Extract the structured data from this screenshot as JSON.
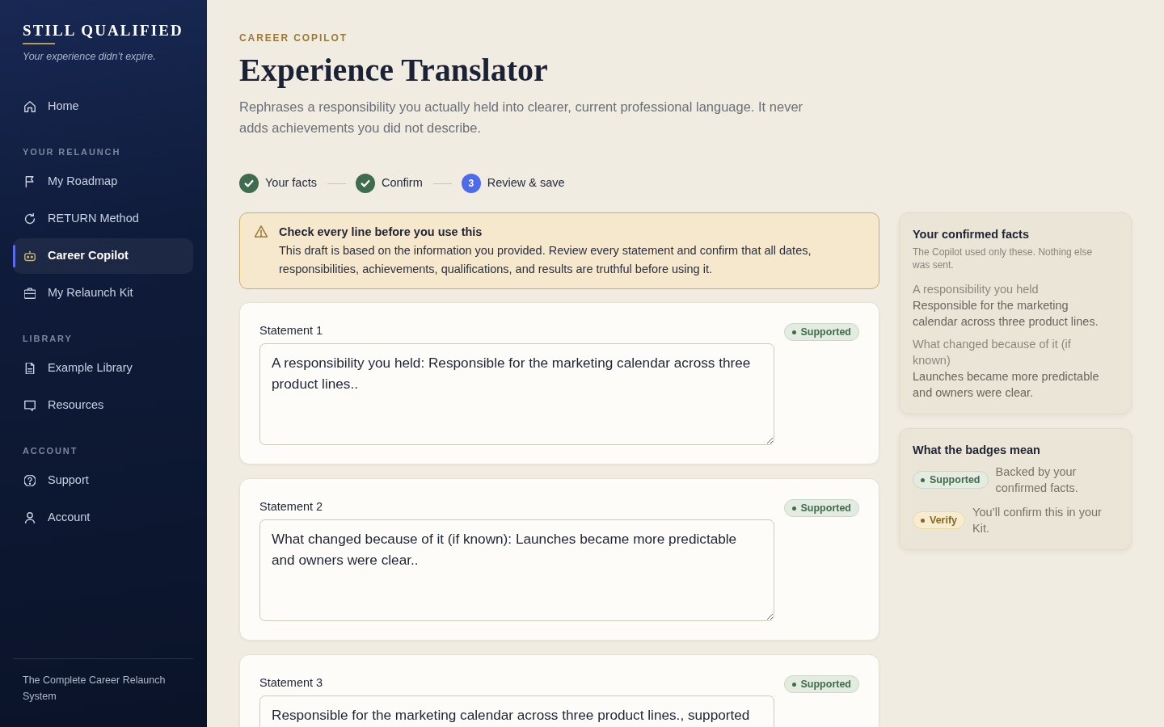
{
  "sidebar": {
    "brand": {
      "name": "STILL QUALIFIED",
      "tagline": "Your experience didn’t expire."
    },
    "sections": [
      {
        "items": [
          {
            "label": "Home",
            "selected": false
          }
        ]
      },
      {
        "heading": "YOUR RELAUNCH",
        "items": [
          {
            "label": "My Roadmap",
            "selected": false
          },
          {
            "label": "RETURN Method",
            "selected": false
          },
          {
            "label": "Career Copilot",
            "selected": true
          },
          {
            "label": "My Relaunch Kit",
            "selected": false
          }
        ]
      },
      {
        "heading": "LIBRARY",
        "items": [
          {
            "label": "Example Library",
            "selected": false
          },
          {
            "label": "Resources",
            "selected": false
          }
        ]
      },
      {
        "heading": "ACCOUNT",
        "items": [
          {
            "label": "Support",
            "selected": false
          },
          {
            "label": "Account",
            "selected": false
          }
        ]
      }
    ],
    "footer": "The Complete Career Relaunch System"
  },
  "main": {
    "eyebrow": "CAREER COPILOT",
    "title": "Experience Translator",
    "description": "Rephrases a responsibility you actually held into clearer, current professional language. It never adds achievements you did not describe.",
    "steps": [
      {
        "label": "Your facts",
        "done": true,
        "selected": false
      },
      {
        "label": "Confirm",
        "done": true,
        "selected": false
      },
      {
        "label": "Review & save",
        "number": "3",
        "done": false,
        "selected": true
      }
    ],
    "alert": {
      "title": "Check every line before you use this",
      "text": "This draft is based on the information you provided. Review every statement and confirm that all dates, responsibilities, achievements, qualifications, and results are truthful before using it."
    },
    "statements": [
      {
        "label": "Statement 1",
        "badge": {
          "label": "Supported",
          "kind": "supported"
        },
        "value": "A responsibility you held: Responsible for the marketing calendar across three product lines.."
      },
      {
        "label": "Statement 2",
        "badge": {
          "label": "Supported",
          "kind": "supported"
        },
        "value": "What changed because of it (if known): Launches became more predictable and owners were clear.."
      },
      {
        "label": "Statement 3",
        "badge": {
          "label": "Supported",
          "kind": "supported"
        },
        "value": "Responsible for the marketing calendar across three product lines., supported"
      }
    ]
  },
  "aside": {
    "facts_card": {
      "title": "Your confirmed facts",
      "subtitle": "The Copilot used only these. Nothing else was sent.",
      "facts": [
        {
          "label": "A responsibility you held",
          "value": "Responsible for the marketing calendar across three product lines."
        },
        {
          "label": "What changed because of it (if known)",
          "value": "Launches became more predictable and owners were clear."
        }
      ]
    },
    "legend_card": {
      "title": "What the badges mean",
      "items": [
        {
          "badge": {
            "label": "Supported",
            "kind": "supported"
          },
          "text": "Backed by your confirmed facts."
        },
        {
          "badge": {
            "label": "Verify",
            "kind": "verify"
          },
          "text": "You’ll confirm this in your Kit."
        }
      ]
    }
  }
}
